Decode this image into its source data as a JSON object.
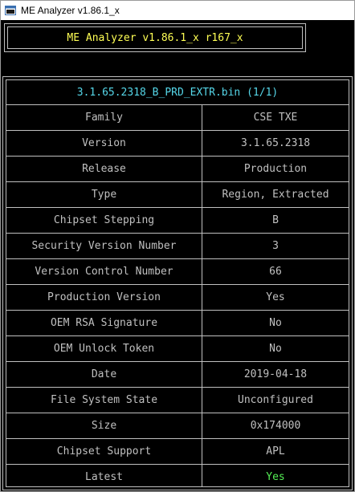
{
  "window": {
    "title": "ME Analyzer v1.86.1_x",
    "icon": "app-console-icon"
  },
  "header": {
    "text": "ME Analyzer v1.86.1_x r167_x"
  },
  "file": {
    "title": "3.1.65.2318_B_PRD_EXTR.bin (1/1)"
  },
  "rows": [
    {
      "label": "Family",
      "value": "CSE TXE"
    },
    {
      "label": "Version",
      "value": "3.1.65.2318"
    },
    {
      "label": "Release",
      "value": "Production"
    },
    {
      "label": "Type",
      "value": "Region, Extracted"
    },
    {
      "label": "Chipset Stepping",
      "value": "B"
    },
    {
      "label": "Security Version Number",
      "value": "3"
    },
    {
      "label": "Version Control Number",
      "value": "66"
    },
    {
      "label": "Production Version",
      "value": "Yes"
    },
    {
      "label": "OEM RSA Signature",
      "value": "No"
    },
    {
      "label": "OEM Unlock Token",
      "value": "No"
    },
    {
      "label": "Date",
      "value": "2019-04-18"
    },
    {
      "label": "File System State",
      "value": "Unconfigured"
    },
    {
      "label": "Size",
      "value": "0x174000"
    },
    {
      "label": "Chipset Support",
      "value": "APL"
    },
    {
      "label": "Latest",
      "value": "Yes"
    }
  ],
  "colors": {
    "background": "#000000",
    "text": "#c0c0c0",
    "header_text": "#ffff55",
    "file_title": "#55d6e8",
    "latest_value": "#55ee55"
  }
}
